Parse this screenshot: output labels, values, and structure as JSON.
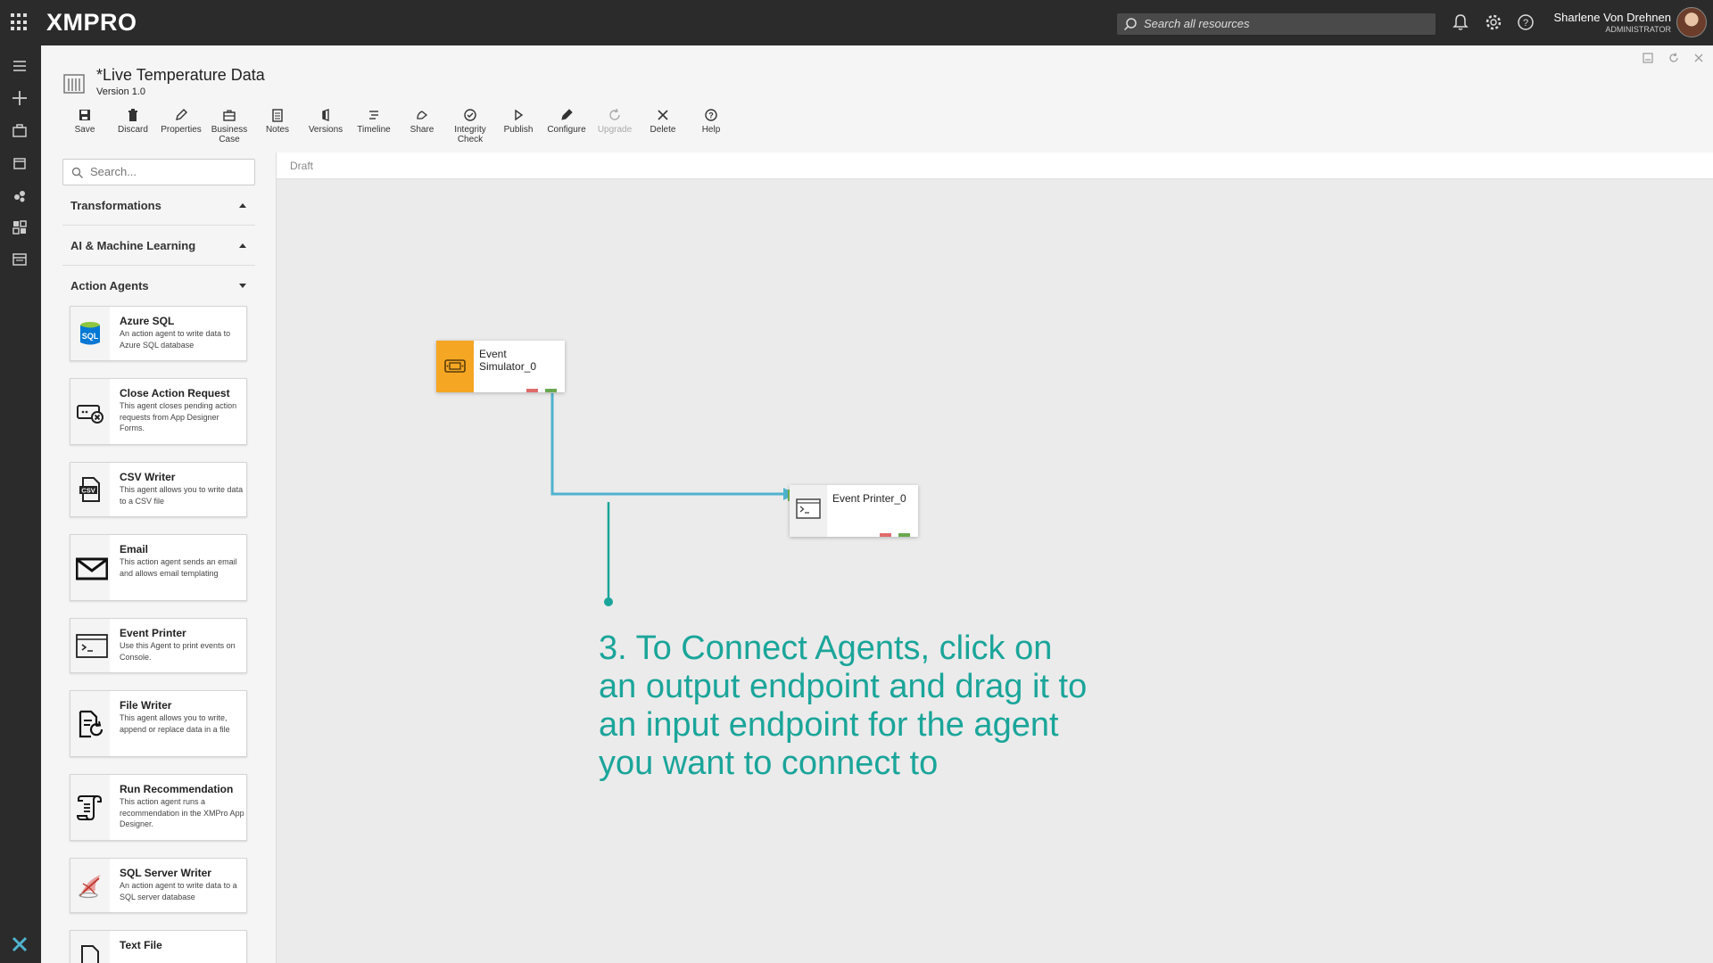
{
  "app": {
    "logo": "XMPRO",
    "search_placeholder": "Search all resources",
    "user_name": "Sharlene Von Drehnen",
    "user_role": "ADMINISTRATOR"
  },
  "document": {
    "title": "*Live Temperature Data",
    "version": "Version 1.0"
  },
  "toolbar": [
    {
      "label": "Save",
      "icon": "save-icon"
    },
    {
      "label": "Discard",
      "icon": "trash-icon"
    },
    {
      "label": "Properties",
      "icon": "pencil-icon"
    },
    {
      "label": "Business Case",
      "icon": "briefcase-icon"
    },
    {
      "label": "Notes",
      "icon": "notes-icon"
    },
    {
      "label": "Versions",
      "icon": "versions-icon"
    },
    {
      "label": "Timeline",
      "icon": "timeline-icon"
    },
    {
      "label": "Share",
      "icon": "share-icon"
    },
    {
      "label": "Integrity Check",
      "icon": "check-circle-icon"
    },
    {
      "label": "Publish",
      "icon": "play-icon"
    },
    {
      "label": "Configure",
      "icon": "pencil-icon"
    },
    {
      "label": "Upgrade",
      "icon": "refresh-icon",
      "disabled": true
    },
    {
      "label": "Delete",
      "icon": "close-icon"
    },
    {
      "label": "Help",
      "icon": "help-icon"
    }
  ],
  "panel": {
    "search_placeholder": "Search...",
    "categories": [
      {
        "label": "Transformations",
        "state": "collapsed"
      },
      {
        "label": "AI & Machine Learning",
        "state": "collapsed"
      },
      {
        "label": "Action Agents",
        "state": "expanded"
      }
    ],
    "agents": [
      {
        "name": "Azure SQL",
        "desc": "An action agent to write data to Azure SQL database",
        "icon": "azure-sql-icon"
      },
      {
        "name": "Close Action Request",
        "desc": "This agent closes pending action requests from App Designer Forms.",
        "icon": "close-action-request-icon"
      },
      {
        "name": "CSV Writer",
        "desc": "This agent allows you to write data to a CSV file",
        "icon": "csv-file-icon"
      },
      {
        "name": "Email",
        "desc": "This action agent sends an email and allows email templating",
        "icon": "envelope-icon"
      },
      {
        "name": "Event Printer",
        "desc": "Use this Agent to print events on Console.",
        "icon": "console-icon"
      },
      {
        "name": "File Writer",
        "desc": "This agent allows you to write, append or replace data in a file",
        "icon": "file-writer-icon"
      },
      {
        "name": "Run Recommendation",
        "desc": "This action agent runs a recommendation in the XMPro App Designer.",
        "icon": "scroll-icon"
      },
      {
        "name": "SQL Server Writer",
        "desc": "An action agent to write data to a SQL server database",
        "icon": "sql-server-icon"
      },
      {
        "name": "Text File",
        "desc": "",
        "icon": "text-file-icon"
      }
    ]
  },
  "canvas": {
    "status": "Draft",
    "nodes": [
      {
        "label": "Event Simulator_0",
        "icon": "simulator-icon"
      },
      {
        "label": "Event Printer_0",
        "icon": "console-icon"
      }
    ],
    "callout": "3. To Connect Agents, click on an output endpoint and drag it to an input endpoint for the agent you want to connect to"
  },
  "colors": {
    "topbar": "#2b2b2b",
    "callout": "#1aa59a",
    "connector": "#4fb3cf",
    "simulator": "#f5a623",
    "endpoint_in": "#6aa84f",
    "endpoint_error": "#e06b6b"
  }
}
